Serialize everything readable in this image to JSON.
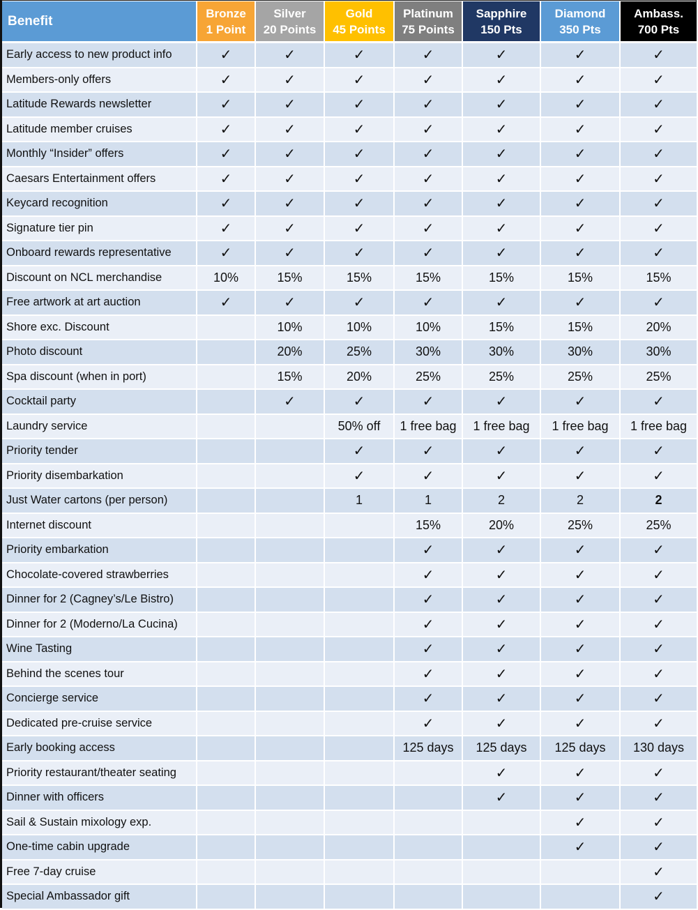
{
  "header": {
    "benefit_label": "Benefit",
    "tiers": [
      {
        "name": "Bronze",
        "points": "1 Point",
        "color": "#f7a535",
        "text": "#ffffff"
      },
      {
        "name": "Silver",
        "points": "20 Points",
        "color": "#a5a5a5",
        "text": "#ffffff"
      },
      {
        "name": "Gold",
        "points": "45 Points",
        "color": "#ffc000",
        "text": "#ffffff"
      },
      {
        "name": "Platinum",
        "points": "75 Points",
        "color": "#7f7f7f",
        "text": "#ffffff"
      },
      {
        "name": "Sapphire",
        "points": "150 Pts",
        "color": "#203864",
        "text": "#ffffff"
      },
      {
        "name": "Diamond",
        "points": "350 Pts",
        "color": "#5b9bd5",
        "text": "#ffffff"
      },
      {
        "name": "Ambass.",
        "points": "700 Pts",
        "color": "#000000",
        "text": "#ffffff"
      }
    ]
  },
  "check_symbol": "✓",
  "rows": [
    {
      "benefit": "Early access to new product info",
      "values": [
        "✓",
        "✓",
        "✓",
        "✓",
        "✓",
        "✓",
        "✓"
      ]
    },
    {
      "benefit": "Members-only offers",
      "values": [
        "✓",
        "✓",
        "✓",
        "✓",
        "✓",
        "✓",
        "✓"
      ]
    },
    {
      "benefit": "Latitude Rewards newsletter",
      "values": [
        "✓",
        "✓",
        "✓",
        "✓",
        "✓",
        "✓",
        "✓"
      ]
    },
    {
      "benefit": "Latitude member cruises",
      "values": [
        "✓",
        "✓",
        "✓",
        "✓",
        "✓",
        "✓",
        "✓"
      ]
    },
    {
      "benefit": "Monthly “Insider” offers",
      "values": [
        "✓",
        "✓",
        "✓",
        "✓",
        "✓",
        "✓",
        "✓"
      ]
    },
    {
      "benefit": "Caesars Entertainment offers",
      "values": [
        "✓",
        "✓",
        "✓",
        "✓",
        "✓",
        "✓",
        "✓"
      ]
    },
    {
      "benefit": "Keycard recognition",
      "values": [
        "✓",
        "✓",
        "✓",
        "✓",
        "✓",
        "✓",
        "✓"
      ]
    },
    {
      "benefit": "Signature tier pin",
      "values": [
        "✓",
        "✓",
        "✓",
        "✓",
        "✓",
        "✓",
        "✓"
      ]
    },
    {
      "benefit": "Onboard rewards representative",
      "values": [
        "✓",
        "✓",
        "✓",
        "✓",
        "✓",
        "✓",
        "✓"
      ]
    },
    {
      "benefit": "Discount on NCL merchandise",
      "values": [
        "10%",
        "15%",
        "15%",
        "15%",
        "15%",
        "15%",
        "15%"
      ]
    },
    {
      "benefit": "Free artwork at art auction",
      "values": [
        "✓",
        "✓",
        "✓",
        "✓",
        "✓",
        "✓",
        "✓"
      ]
    },
    {
      "benefit": "Shore exc. Discount",
      "values": [
        "",
        "10%",
        "10%",
        "10%",
        "15%",
        "15%",
        "20%"
      ]
    },
    {
      "benefit": "Photo discount",
      "values": [
        "",
        "20%",
        "25%",
        "30%",
        "30%",
        "30%",
        "30%"
      ]
    },
    {
      "benefit": "Spa discount (when in port)",
      "values": [
        "",
        "15%",
        "20%",
        "25%",
        "25%",
        "25%",
        "25%"
      ]
    },
    {
      "benefit": "Cocktail party",
      "values": [
        "",
        "✓",
        "✓",
        "✓",
        "✓",
        "✓",
        "✓"
      ]
    },
    {
      "benefit": "Laundry service",
      "values": [
        "",
        "",
        "50% off",
        "1 free bag",
        "1 free bag",
        "1 free bag",
        "1 free bag"
      ]
    },
    {
      "benefit": "Priority tender",
      "values": [
        "",
        "",
        "✓",
        "✓",
        "✓",
        "✓",
        "✓"
      ]
    },
    {
      "benefit": "Priority disembarkation",
      "values": [
        "",
        "",
        "✓",
        "✓",
        "✓",
        "✓",
        "✓"
      ]
    },
    {
      "benefit": "Just Water cartons (per person)",
      "values": [
        "",
        "",
        "1",
        "1",
        "2",
        "2",
        "2"
      ],
      "bold_last": true
    },
    {
      "benefit": "Internet discount",
      "values": [
        "",
        "",
        "",
        "15%",
        "20%",
        "25%",
        "25%"
      ]
    },
    {
      "benefit": "Priority embarkation",
      "values": [
        "",
        "",
        "",
        "✓",
        "✓",
        "✓",
        "✓"
      ]
    },
    {
      "benefit": "Chocolate-covered strawberries",
      "values": [
        "",
        "",
        "",
        "✓",
        "✓",
        "✓",
        "✓"
      ]
    },
    {
      "benefit": "Dinner for 2 (Cagney’s/Le Bistro)",
      "values": [
        "",
        "",
        "",
        "✓",
        "✓",
        "✓",
        "✓"
      ]
    },
    {
      "benefit": "Dinner for 2 (Moderno/La Cucina)",
      "values": [
        "",
        "",
        "",
        "✓",
        "✓",
        "✓",
        "✓"
      ]
    },
    {
      "benefit": "Wine Tasting",
      "values": [
        "",
        "",
        "",
        "✓",
        "✓",
        "✓",
        "✓"
      ]
    },
    {
      "benefit": "Behind the scenes tour",
      "values": [
        "",
        "",
        "",
        "✓",
        "✓",
        "✓",
        "✓"
      ]
    },
    {
      "benefit": "Concierge service",
      "values": [
        "",
        "",
        "",
        "✓",
        "✓",
        "✓",
        "✓"
      ]
    },
    {
      "benefit": "Dedicated pre-cruise service",
      "values": [
        "",
        "",
        "",
        "✓",
        "✓",
        "✓",
        "✓"
      ]
    },
    {
      "benefit": "Early booking access",
      "values": [
        "",
        "",
        "",
        "125 days",
        "125 days",
        "125 days",
        "130 days"
      ]
    },
    {
      "benefit": "Priority restaurant/theater seating",
      "values": [
        "",
        "",
        "",
        "",
        "✓",
        "✓",
        "✓"
      ]
    },
    {
      "benefit": "Dinner with officers",
      "values": [
        "",
        "",
        "",
        "",
        "✓",
        "✓",
        "✓"
      ]
    },
    {
      "benefit": "Sail & Sustain mixology exp.",
      "values": [
        "",
        "",
        "",
        "",
        "",
        "✓",
        "✓"
      ]
    },
    {
      "benefit": "One-time cabin upgrade",
      "values": [
        "",
        "",
        "",
        "",
        "",
        "✓",
        "✓"
      ]
    },
    {
      "benefit": "Free 7-day cruise",
      "values": [
        "",
        "",
        "",
        "",
        "",
        "",
        "✓"
      ]
    },
    {
      "benefit": "Special Ambassador gift",
      "values": [
        "",
        "",
        "",
        "",
        "",
        "",
        "✓"
      ]
    }
  ]
}
